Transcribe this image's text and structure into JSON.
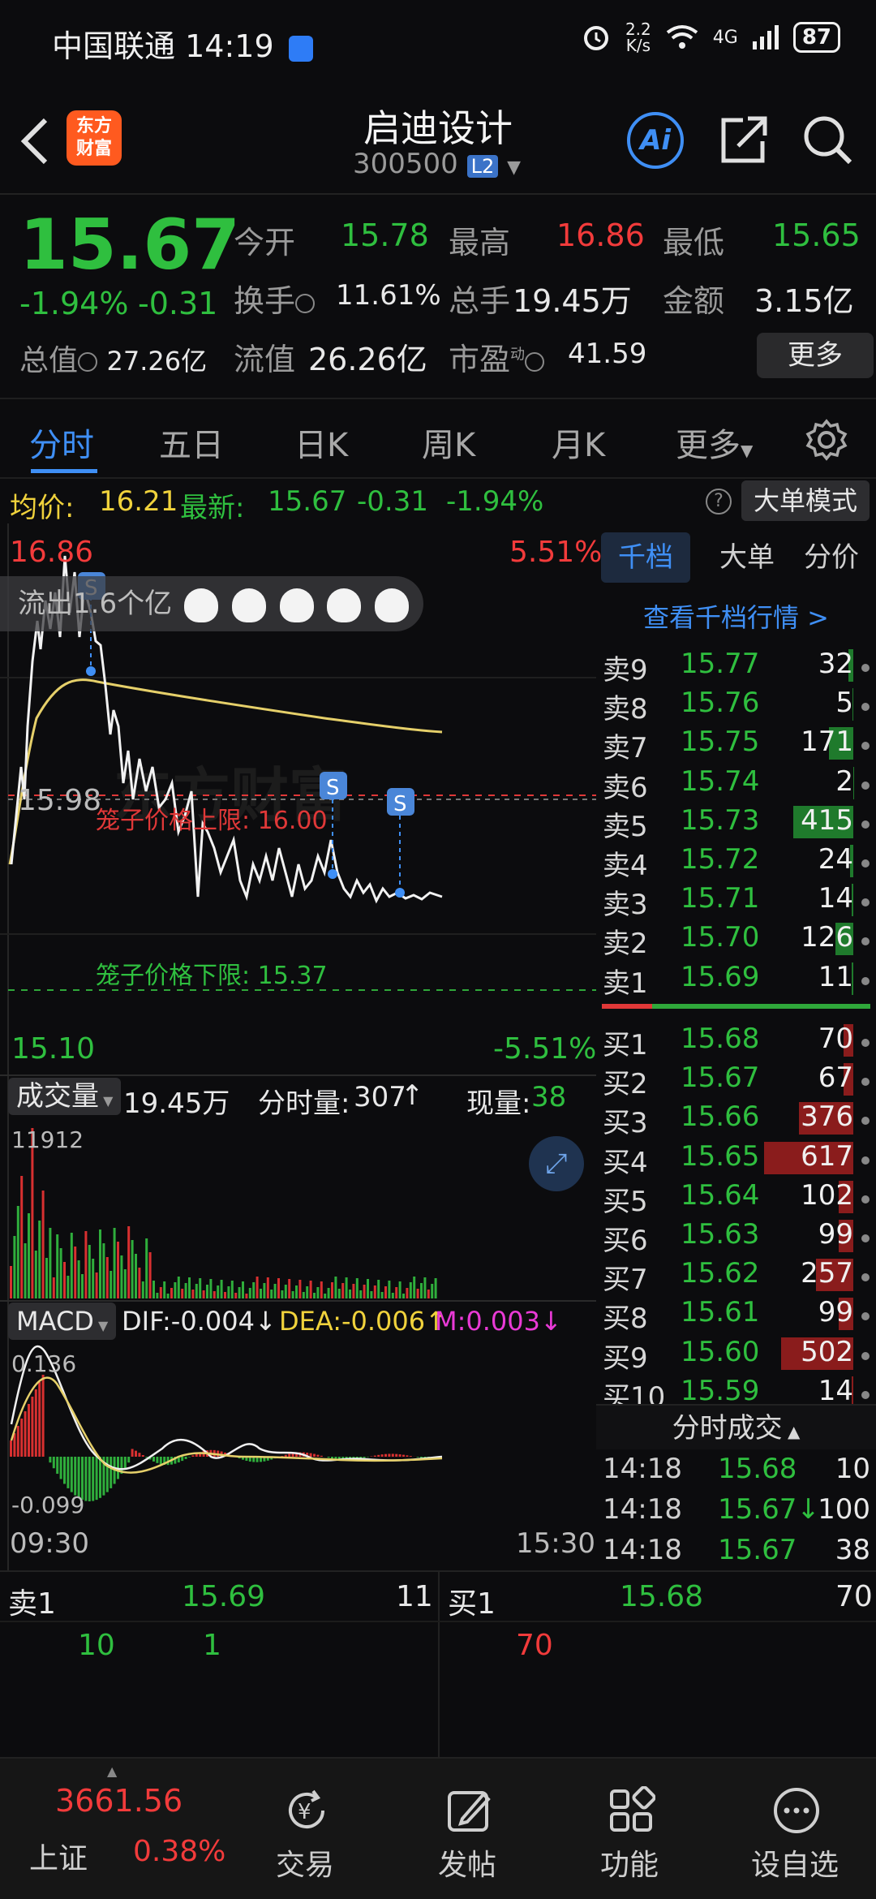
{
  "status_bar": {
    "carrier": "中国联通",
    "time": "14:19",
    "net_speed_value": "2.2",
    "net_speed_unit": "K/s",
    "network": "4G",
    "battery": "87"
  },
  "header": {
    "logo_line1": "东方",
    "logo_line2": "财富",
    "title": "启迪设计",
    "code": "300500",
    "level": "L2",
    "ai_label": "Ai"
  },
  "quote": {
    "price": "15.67",
    "change_pct": "-1.94%",
    "change": "-0.31",
    "open_label": "今开",
    "open": "15.78",
    "high_label": "最高",
    "high": "16.86",
    "low_label": "最低",
    "low": "15.65",
    "turnover_label": "换手",
    "turnover": "11.61%",
    "volume_label": "总手",
    "volume": "19.45万",
    "amount_label": "金额",
    "amount": "3.15亿",
    "mktcap_label": "总值",
    "mktcap": "27.26亿",
    "float_label": "流值",
    "float": "26.26亿",
    "pe_label": "市盈",
    "pe_sup": "动",
    "pe": "41.59",
    "more_button": "更多"
  },
  "tabs": [
    "分时",
    "五日",
    "日K",
    "周K",
    "月K",
    "更多"
  ],
  "chart_header": {
    "avg_label": "均价:",
    "avg": "16.21",
    "last_label": "最新:",
    "last": "15.67",
    "last_change": "-0.31",
    "last_pct": "-1.94%",
    "mode_button": "大单模式"
  },
  "chart": {
    "top_price": "16.86",
    "top_pct": "5.51%",
    "mid_price": "15.98",
    "bottom_price": "15.10",
    "bottom_pct": "-5.51%",
    "outflow_text": "流出1.6个亿",
    "cage_upper": "笼子价格上限:  16.00",
    "cage_lower": "笼子价格下限:  15.37",
    "watermark": "东方财富",
    "s_marker": "S"
  },
  "chart_data": {
    "type": "line",
    "x": [
      "09:30",
      "15:30"
    ],
    "series": [],
    "ylim": [
      15.1,
      16.86
    ]
  },
  "volume": {
    "selector": "成交量",
    "total": "19.45万",
    "minute_label": "分时量:",
    "minute": "307",
    "current_label": "现量:",
    "current": "38",
    "max": "11912"
  },
  "macd": {
    "selector": "MACD",
    "dif": "DIF:-0.004",
    "dea": "DEA:-0.006",
    "m": "M:0.003",
    "top": "0.136",
    "bottom": "-0.099"
  },
  "time_axis": {
    "start": "09:30",
    "end": "15:30"
  },
  "book_tabs": [
    "千档",
    "大单",
    "分价"
  ],
  "book_link": "查看千档行情 >",
  "asks": [
    {
      "label": "卖9",
      "price": "15.77",
      "vol": "32"
    },
    {
      "label": "卖8",
      "price": "15.76",
      "vol": "5"
    },
    {
      "label": "卖7",
      "price": "15.75",
      "vol": "171"
    },
    {
      "label": "卖6",
      "price": "15.74",
      "vol": "2"
    },
    {
      "label": "卖5",
      "price": "15.73",
      "vol": "415"
    },
    {
      "label": "卖4",
      "price": "15.72",
      "vol": "24"
    },
    {
      "label": "卖3",
      "price": "15.71",
      "vol": "14"
    },
    {
      "label": "卖2",
      "price": "15.70",
      "vol": "126"
    },
    {
      "label": "卖1",
      "price": "15.69",
      "vol": "11"
    }
  ],
  "bids": [
    {
      "label": "买1",
      "price": "15.68",
      "vol": "70"
    },
    {
      "label": "买2",
      "price": "15.67",
      "vol": "67"
    },
    {
      "label": "买3",
      "price": "15.66",
      "vol": "376"
    },
    {
      "label": "买4",
      "price": "15.65",
      "vol": "617"
    },
    {
      "label": "买5",
      "price": "15.64",
      "vol": "102"
    },
    {
      "label": "买6",
      "price": "15.63",
      "vol": "99"
    },
    {
      "label": "买7",
      "price": "15.62",
      "vol": "257"
    },
    {
      "label": "买8",
      "price": "15.61",
      "vol": "99"
    },
    {
      "label": "买9",
      "price": "15.60",
      "vol": "502"
    },
    {
      "label": "买10",
      "price": "15.59",
      "vol": "14"
    }
  ],
  "trades_title": "分时成交",
  "trades": [
    {
      "time": "14:18",
      "price": "15.68",
      "vol": "10"
    },
    {
      "time": "14:18",
      "price": "15.67↓",
      "vol": "100"
    },
    {
      "time": "14:18",
      "price": "15.67",
      "vol": "38"
    }
  ],
  "bottom_info": {
    "sell_label": "卖1",
    "sell_price": "15.69",
    "sell_vol": "11",
    "buy_label": "买1",
    "buy_price": "15.68",
    "buy_vol": "70",
    "sell_q1": "10",
    "sell_q2": "1",
    "buy_q1": "70"
  },
  "nav": {
    "index_value": "3661.56",
    "index_name": "上证",
    "index_pct": "0.38%",
    "items": [
      "交易",
      "发帖",
      "功能",
      "设自选"
    ],
    "trade_icon_char": "¥"
  }
}
